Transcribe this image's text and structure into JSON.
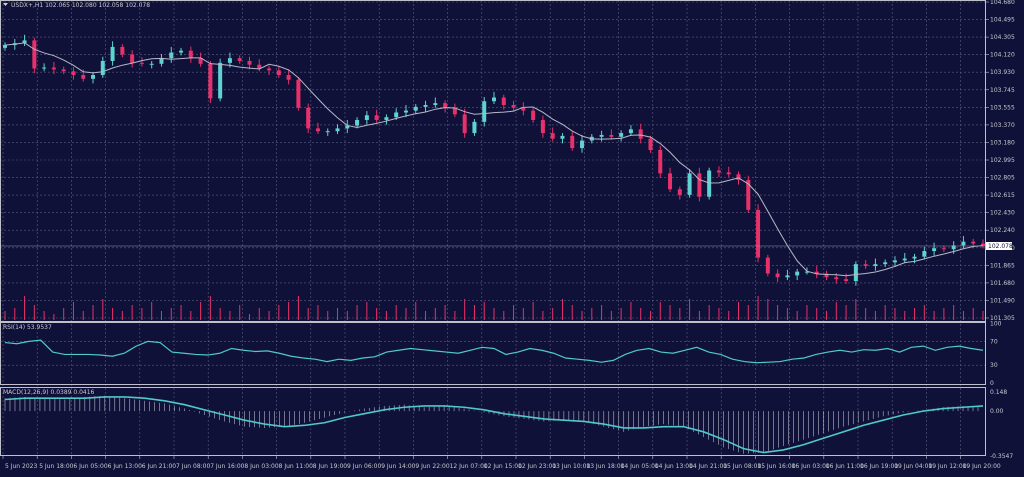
{
  "header": {
    "symbol_info": "USDX+,H1  102.065 102.080 102.058 102.078"
  },
  "current_price_label": "102.078",
  "colors": {
    "background": "#0f1138",
    "bull": "#5fd3d0",
    "bear": "#e8306a",
    "ma": "#b8b8c8",
    "indicator": "#4fc9c9",
    "grid": "#5a5c80"
  },
  "chart_data": [
    {
      "type": "candlestick",
      "title": "USDX+,H1",
      "y_ticks": [
        "104.680",
        "104.495",
        "104.305",
        "104.120",
        "103.930",
        "103.745",
        "103.555",
        "103.370",
        "103.180",
        "102.995",
        "102.805",
        "102.615",
        "102.430",
        "102.240",
        "102.050",
        "101.865",
        "101.680",
        "101.490",
        "101.305"
      ],
      "ylim": [
        101.305,
        104.68
      ],
      "x_ticks": [
        "5 Jun 2023",
        "5 Jun 18:00",
        "6 Jun 05:00",
        "6 Jun 13:00",
        "6 Jun 21:00",
        "7 Jun 08:00",
        "7 Jun 16:00",
        "8 Jun 03:00",
        "8 Jun 11:00",
        "8 Jun 19:00",
        "9 Jun 06:00",
        "9 Jun 14:00",
        "9 Jun 22:00",
        "12 Jun 07:00",
        "12 Jun 15:00",
        "12 Jun 23:00",
        "13 Jun 10:00",
        "13 Jun 18:00",
        "14 Jun 05:00",
        "14 Jun 13:00",
        "14 Jun 21:00",
        "15 Jun 08:00",
        "15 Jun 16:00",
        "16 Jun 03:00",
        "16 Jun 11:00",
        "16 Jun 19:00",
        "19 Jun 04:00",
        "19 Jun 12:00",
        "19 Jun 20:00"
      ],
      "closes": [
        104.22,
        104.24,
        104.27,
        103.97,
        103.98,
        103.96,
        103.94,
        103.9,
        103.86,
        103.9,
        104.05,
        104.2,
        104.12,
        104.03,
        104.02,
        104.02,
        104.08,
        104.14,
        104.16,
        104.08,
        104.02,
        103.65,
        104.03,
        104.08,
        104.05,
        104.01,
        103.97,
        103.95,
        103.9,
        103.85,
        103.55,
        103.33,
        103.3,
        103.3,
        103.33,
        103.36,
        103.42,
        103.47,
        103.42,
        103.45,
        103.5,
        103.52,
        103.56,
        103.58,
        103.6,
        103.55,
        103.48,
        103.28,
        103.4,
        103.62,
        103.66,
        103.58,
        103.55,
        103.52,
        103.42,
        103.28,
        103.22,
        103.25,
        103.12,
        103.2,
        103.24,
        103.26,
        103.24,
        103.28,
        103.32,
        103.22,
        103.1,
        102.85,
        102.68,
        102.62,
        102.85,
        102.6,
        102.88,
        102.86,
        102.84,
        102.78,
        102.46,
        101.95,
        101.78,
        101.74,
        101.76,
        101.8,
        101.8,
        101.78,
        101.74,
        101.72,
        101.7,
        101.88,
        101.86,
        101.88,
        101.9,
        101.92,
        101.94,
        101.96,
        102.02,
        102.05,
        102.04,
        102.08,
        102.12,
        102.1,
        102.078
      ],
      "volumes": [
        3,
        4,
        8,
        5,
        3,
        2,
        4,
        6,
        3,
        5,
        7,
        4,
        3,
        5,
        4,
        6,
        3,
        4,
        5,
        3,
        6,
        8,
        4,
        3,
        5,
        2,
        4,
        3,
        5,
        6,
        8,
        4,
        5,
        3,
        4,
        3,
        5,
        6,
        4,
        3,
        5,
        4,
        6,
        3,
        4,
        5,
        3,
        7,
        5,
        6,
        4,
        3,
        5,
        4,
        6,
        3,
        4,
        7,
        5,
        3,
        4,
        5,
        3,
        4,
        6,
        4,
        3,
        6,
        5,
        4,
        7,
        3,
        5,
        4,
        3,
        6,
        5,
        8,
        7,
        5,
        4,
        3,
        5,
        4,
        3,
        6,
        5,
        7,
        4,
        3,
        5,
        4,
        3,
        4,
        5,
        3,
        4,
        5,
        3,
        4,
        3
      ]
    },
    {
      "type": "line",
      "title": "RSI(14) 53.9537",
      "ylim": [
        0,
        100
      ],
      "y_ticks": [
        "100",
        "70",
        "30",
        "0"
      ],
      "values": [
        68,
        66,
        70,
        72,
        52,
        48,
        48,
        48,
        47,
        45,
        50,
        62,
        70,
        68,
        52,
        50,
        48,
        47,
        50,
        58,
        55,
        53,
        54,
        50,
        45,
        42,
        40,
        36,
        40,
        38,
        42,
        44,
        52,
        55,
        58,
        56,
        54,
        52,
        50,
        55,
        60,
        58,
        48,
        52,
        58,
        55,
        50,
        42,
        40,
        38,
        35,
        38,
        48,
        55,
        58,
        52,
        50,
        55,
        60,
        52,
        48,
        40,
        36,
        34,
        35,
        36,
        40,
        42,
        48,
        52,
        55,
        52,
        56,
        55,
        58,
        52,
        60,
        62,
        55,
        60,
        62,
        58,
        55
      ]
    },
    {
      "type": "bar",
      "title": "MACD(12,26,9) 0.0389 0.0416",
      "ylim": [
        -0.3547,
        0.148
      ],
      "y_ticks": [
        "0.148",
        "0.00",
        "-0.3547"
      ],
      "macd": [
        0.1,
        0.11,
        0.1,
        0.09,
        0.11,
        0.12,
        0.1,
        0.08,
        0.06,
        0.02,
        -0.03,
        -0.08,
        -0.12,
        -0.13,
        -0.12,
        -0.09,
        -0.05,
        -0.01,
        0.02,
        0.04,
        0.05,
        0.03,
        0.04,
        0.02,
        -0.01,
        -0.04,
        -0.06,
        -0.08,
        -0.07,
        -0.08,
        -0.12,
        -0.16,
        -0.12,
        -0.1,
        -0.12,
        -0.2,
        -0.28,
        -0.33,
        -0.32,
        -0.27,
        -0.22,
        -0.17,
        -0.12,
        -0.08,
        -0.04,
        -0.01,
        0.01,
        0.03,
        0.04,
        0.04
      ],
      "signal": [
        0.09,
        0.1,
        0.1,
        0.1,
        0.1,
        0.11,
        0.11,
        0.1,
        0.08,
        0.05,
        0.01,
        -0.03,
        -0.07,
        -0.1,
        -0.12,
        -0.11,
        -0.09,
        -0.05,
        -0.02,
        0.01,
        0.03,
        0.04,
        0.04,
        0.03,
        0.01,
        -0.02,
        -0.04,
        -0.06,
        -0.07,
        -0.08,
        -0.1,
        -0.13,
        -0.13,
        -0.12,
        -0.12,
        -0.16,
        -0.22,
        -0.29,
        -0.32,
        -0.3,
        -0.26,
        -0.21,
        -0.16,
        -0.11,
        -0.07,
        -0.03,
        0.0,
        0.02,
        0.03,
        0.04
      ]
    }
  ]
}
